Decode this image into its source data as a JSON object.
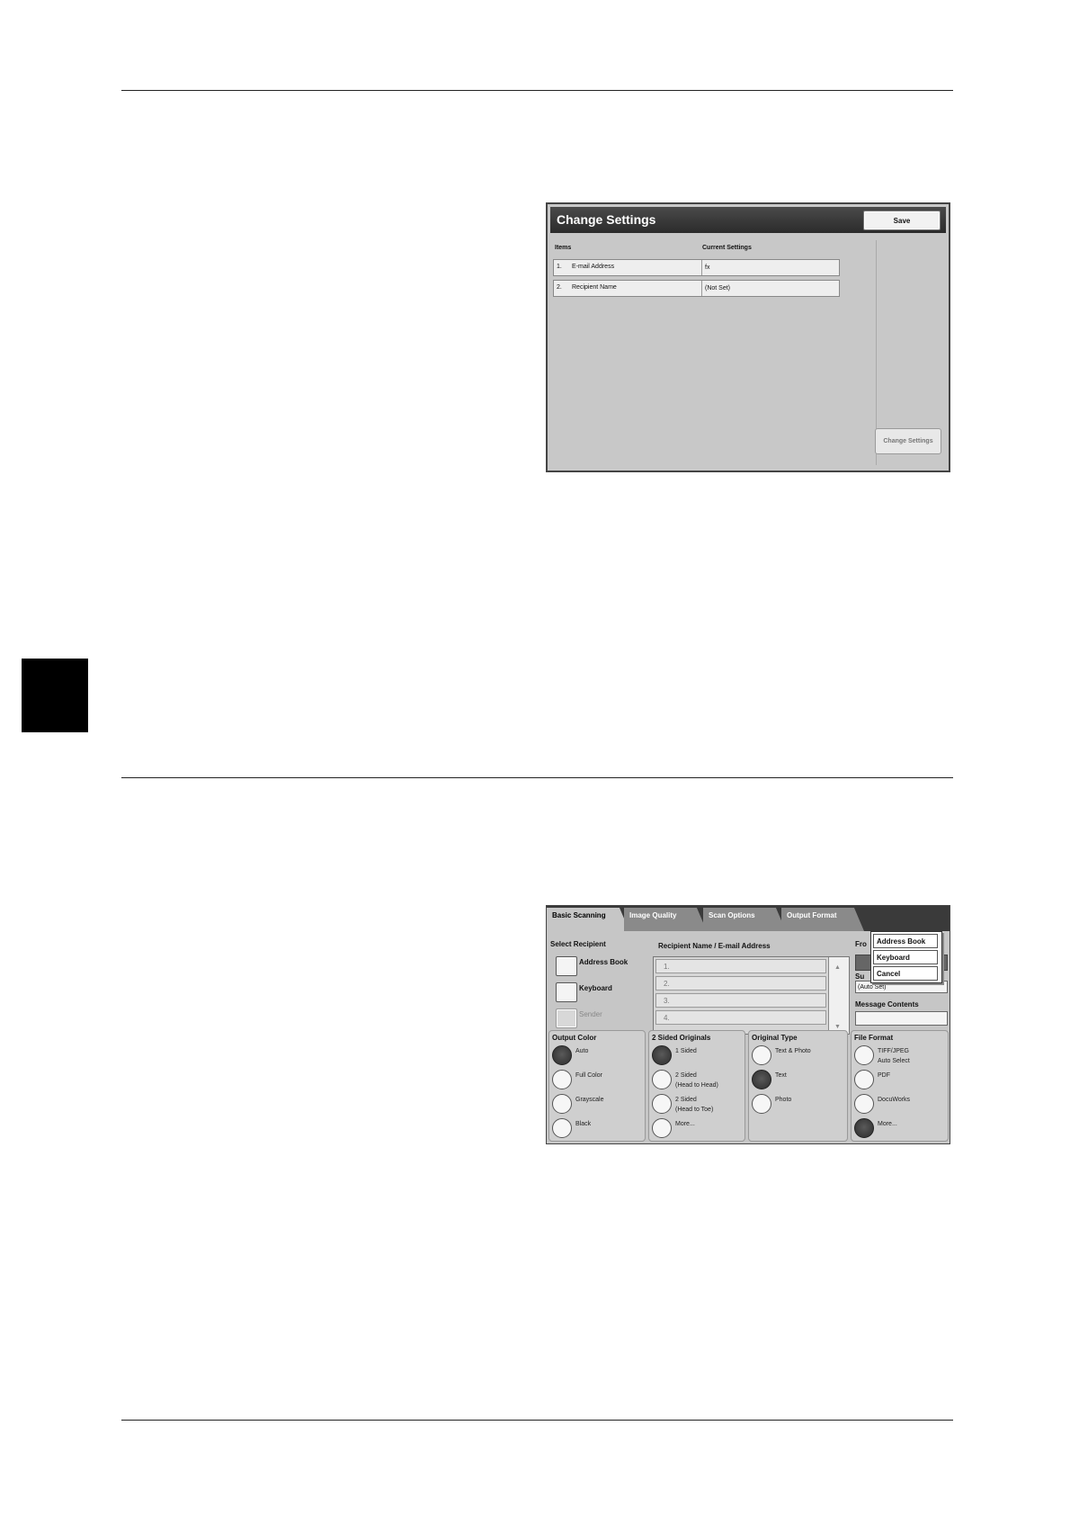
{
  "change_settings_screen": {
    "title": "Change Settings",
    "save_label": "Save",
    "col_items": "Items",
    "col_current": "Current Settings",
    "rows": [
      {
        "num": "1.",
        "name": "E-mail Address",
        "value": "fx"
      },
      {
        "num": "2.",
        "name": "Recipient Name",
        "value": "(Not Set)"
      }
    ],
    "change_button": "Change Settings"
  },
  "scan_screen": {
    "tabs": [
      "Basic Scanning",
      "Image Quality",
      "Scan Options",
      "Output Format"
    ],
    "select_recipient": "Select Recipient",
    "buttons": {
      "address_book": "Address Book",
      "keyboard": "Keyboard",
      "sender": "Sender"
    },
    "recipient_header": "Recipient Name / E-mail Address",
    "recipient_rows": [
      "1.",
      "2.",
      "3.",
      "4."
    ],
    "from_label": "Fro",
    "subject_label": "Su",
    "subject_value": "(Auto Set)",
    "message_label": "Message Contents",
    "popup": [
      "Address Book",
      "Keyboard",
      "Cancel"
    ],
    "output_color": {
      "title": "Output Color",
      "options": [
        "Auto",
        "Full Color",
        "Grayscale",
        "Black"
      ],
      "selected": 0
    },
    "two_sided": {
      "title": "2 Sided Originals",
      "options": [
        "1 Sided",
        "2 Sided\n(Head to Head)",
        "2 Sided\n(Head to Toe)",
        "More..."
      ],
      "selected": 0
    },
    "original_type": {
      "title": "Original Type",
      "options": [
        "Text & Photo",
        "Text",
        "Photo"
      ],
      "selected": 1
    },
    "file_format": {
      "title": "File Format",
      "options": [
        "TIFF/JPEG\nAuto Select",
        "PDF",
        "DocuWorks",
        "More..."
      ],
      "selected": 3
    }
  }
}
